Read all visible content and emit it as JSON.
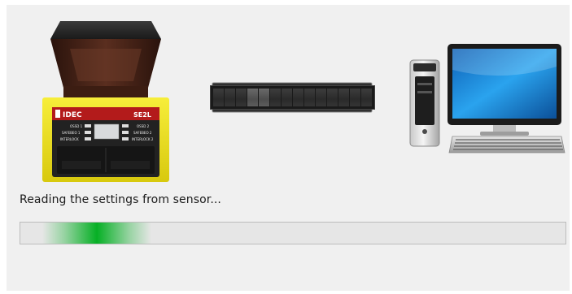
{
  "dialog": {
    "status_text": "Reading the settings from sensor...",
    "progress": {
      "position": 0.14,
      "highlight_width": 0.2,
      "indeterminate": true,
      "color": "#06b025"
    }
  },
  "sensor": {
    "brand": "IDEC",
    "model": "SE2L",
    "body_color": "#f2e31a",
    "head_color": "#4a2418",
    "left_leds": [
      "OSSD 1",
      "SAFEBEO 1",
      "INTERLOCK"
    ],
    "right_leds": [
      "OSSD 2",
      "SAFEBEO 2",
      "INTERLOCK 2"
    ]
  },
  "transfer_indicator": {
    "cells": 14,
    "lit_cells": [
      3,
      4
    ]
  },
  "computer": {
    "screen_color": "#1e88d6"
  }
}
